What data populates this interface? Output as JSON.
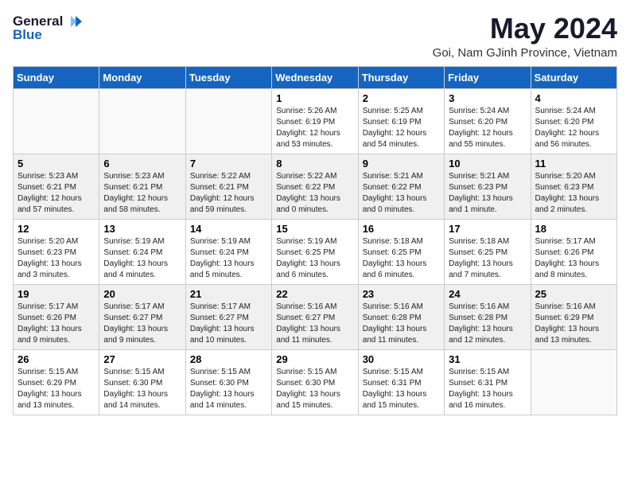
{
  "header": {
    "logo_general": "General",
    "logo_blue": "Blue",
    "month": "May 2024",
    "location": "Goi, Nam GJinh Province, Vietnam"
  },
  "weekdays": [
    "Sunday",
    "Monday",
    "Tuesday",
    "Wednesday",
    "Thursday",
    "Friday",
    "Saturday"
  ],
  "weeks": [
    [
      {
        "day": "",
        "info": ""
      },
      {
        "day": "",
        "info": ""
      },
      {
        "day": "",
        "info": ""
      },
      {
        "day": "1",
        "info": "Sunrise: 5:26 AM\nSunset: 6:19 PM\nDaylight: 12 hours\nand 53 minutes."
      },
      {
        "day": "2",
        "info": "Sunrise: 5:25 AM\nSunset: 6:19 PM\nDaylight: 12 hours\nand 54 minutes."
      },
      {
        "day": "3",
        "info": "Sunrise: 5:24 AM\nSunset: 6:20 PM\nDaylight: 12 hours\nand 55 minutes."
      },
      {
        "day": "4",
        "info": "Sunrise: 5:24 AM\nSunset: 6:20 PM\nDaylight: 12 hours\nand 56 minutes."
      }
    ],
    [
      {
        "day": "5",
        "info": "Sunrise: 5:23 AM\nSunset: 6:21 PM\nDaylight: 12 hours\nand 57 minutes."
      },
      {
        "day": "6",
        "info": "Sunrise: 5:23 AM\nSunset: 6:21 PM\nDaylight: 12 hours\nand 58 minutes."
      },
      {
        "day": "7",
        "info": "Sunrise: 5:22 AM\nSunset: 6:21 PM\nDaylight: 12 hours\nand 59 minutes."
      },
      {
        "day": "8",
        "info": "Sunrise: 5:22 AM\nSunset: 6:22 PM\nDaylight: 13 hours\nand 0 minutes."
      },
      {
        "day": "9",
        "info": "Sunrise: 5:21 AM\nSunset: 6:22 PM\nDaylight: 13 hours\nand 0 minutes."
      },
      {
        "day": "10",
        "info": "Sunrise: 5:21 AM\nSunset: 6:23 PM\nDaylight: 13 hours\nand 1 minute."
      },
      {
        "day": "11",
        "info": "Sunrise: 5:20 AM\nSunset: 6:23 PM\nDaylight: 13 hours\nand 2 minutes."
      }
    ],
    [
      {
        "day": "12",
        "info": "Sunrise: 5:20 AM\nSunset: 6:23 PM\nDaylight: 13 hours\nand 3 minutes."
      },
      {
        "day": "13",
        "info": "Sunrise: 5:19 AM\nSunset: 6:24 PM\nDaylight: 13 hours\nand 4 minutes."
      },
      {
        "day": "14",
        "info": "Sunrise: 5:19 AM\nSunset: 6:24 PM\nDaylight: 13 hours\nand 5 minutes."
      },
      {
        "day": "15",
        "info": "Sunrise: 5:19 AM\nSunset: 6:25 PM\nDaylight: 13 hours\nand 6 minutes."
      },
      {
        "day": "16",
        "info": "Sunrise: 5:18 AM\nSunset: 6:25 PM\nDaylight: 13 hours\nand 6 minutes."
      },
      {
        "day": "17",
        "info": "Sunrise: 5:18 AM\nSunset: 6:25 PM\nDaylight: 13 hours\nand 7 minutes."
      },
      {
        "day": "18",
        "info": "Sunrise: 5:17 AM\nSunset: 6:26 PM\nDaylight: 13 hours\nand 8 minutes."
      }
    ],
    [
      {
        "day": "19",
        "info": "Sunrise: 5:17 AM\nSunset: 6:26 PM\nDaylight: 13 hours\nand 9 minutes."
      },
      {
        "day": "20",
        "info": "Sunrise: 5:17 AM\nSunset: 6:27 PM\nDaylight: 13 hours\nand 9 minutes."
      },
      {
        "day": "21",
        "info": "Sunrise: 5:17 AM\nSunset: 6:27 PM\nDaylight: 13 hours\nand 10 minutes."
      },
      {
        "day": "22",
        "info": "Sunrise: 5:16 AM\nSunset: 6:27 PM\nDaylight: 13 hours\nand 11 minutes."
      },
      {
        "day": "23",
        "info": "Sunrise: 5:16 AM\nSunset: 6:28 PM\nDaylight: 13 hours\nand 11 minutes."
      },
      {
        "day": "24",
        "info": "Sunrise: 5:16 AM\nSunset: 6:28 PM\nDaylight: 13 hours\nand 12 minutes."
      },
      {
        "day": "25",
        "info": "Sunrise: 5:16 AM\nSunset: 6:29 PM\nDaylight: 13 hours\nand 13 minutes."
      }
    ],
    [
      {
        "day": "26",
        "info": "Sunrise: 5:15 AM\nSunset: 6:29 PM\nDaylight: 13 hours\nand 13 minutes."
      },
      {
        "day": "27",
        "info": "Sunrise: 5:15 AM\nSunset: 6:30 PM\nDaylight: 13 hours\nand 14 minutes."
      },
      {
        "day": "28",
        "info": "Sunrise: 5:15 AM\nSunset: 6:30 PM\nDaylight: 13 hours\nand 14 minutes."
      },
      {
        "day": "29",
        "info": "Sunrise: 5:15 AM\nSunset: 6:30 PM\nDaylight: 13 hours\nand 15 minutes."
      },
      {
        "day": "30",
        "info": "Sunrise: 5:15 AM\nSunset: 6:31 PM\nDaylight: 13 hours\nand 15 minutes."
      },
      {
        "day": "31",
        "info": "Sunrise: 5:15 AM\nSunset: 6:31 PM\nDaylight: 13 hours\nand 16 minutes."
      },
      {
        "day": "",
        "info": ""
      }
    ]
  ]
}
